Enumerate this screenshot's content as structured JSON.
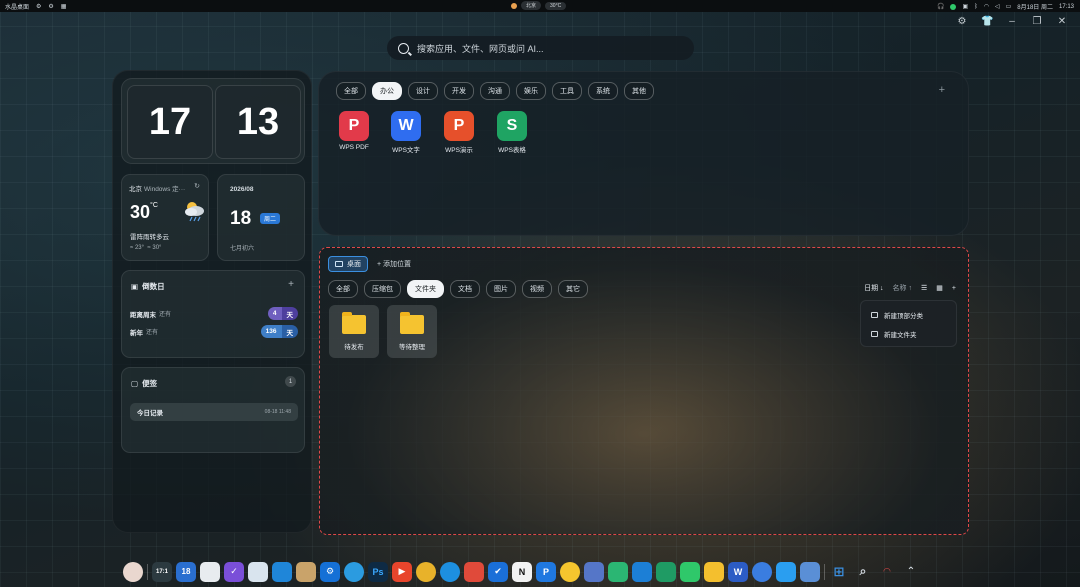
{
  "topbar": {
    "app_name": "水晶桌面",
    "center_label": "北京",
    "center_temp": "30°C",
    "date": "8月18日 周二",
    "time": "17:13"
  },
  "search": {
    "placeholder": "搜索应用、文件、网页或问 AI..."
  },
  "clock": {
    "hour": "17",
    "minute": "13"
  },
  "weather": {
    "city": "北京",
    "source": "Windows 定···",
    "temp": "30",
    "unit": "°C",
    "desc": "雷阵雨转多云",
    "low": "≈ 23°",
    "high": "≈ 30°"
  },
  "date_card": {
    "year_month": "2026/08",
    "day": "18",
    "weekday": "周二",
    "lunar": "七月初六"
  },
  "countdown": {
    "title": "倒数日",
    "items": [
      {
        "name": "距离周末",
        "prefix": "还有",
        "days": "4",
        "unit": "天",
        "color_n": "#6f5fbf",
        "color_u": "#4e3f9e"
      },
      {
        "name": "新年",
        "prefix": "还有",
        "days": "136",
        "unit": "天",
        "color_n": "#3f7fc7",
        "color_u": "#2a5fa5"
      }
    ]
  },
  "notes": {
    "title": "便签",
    "count": "1",
    "items": [
      {
        "title": "今日记录",
        "time": "08-18 11:48"
      }
    ]
  },
  "app_tabs": [
    "全部",
    "办公",
    "设计",
    "开发",
    "沟通",
    "娱乐",
    "工具",
    "系统",
    "其他"
  ],
  "app_tabs_active": "办公",
  "apps": [
    {
      "name": "WPS PDF",
      "glyph": "P",
      "color": "#e23a4a"
    },
    {
      "name": "WPS文字",
      "glyph": "W",
      "color": "#2f6df0"
    },
    {
      "name": "WPS演示",
      "glyph": "P",
      "color": "#e6502b"
    },
    {
      "name": "WPS表格",
      "glyph": "S",
      "color": "#1fa463"
    }
  ],
  "files": {
    "location": "桌面",
    "add_location": "+ 添加位置",
    "tabs": [
      "全部",
      "压缩包",
      "文件夹",
      "文档",
      "图片",
      "视频",
      "其它"
    ],
    "active_tab": "文件夹",
    "sort_date": "日期 ↓",
    "sort_name": "名称 ↑",
    "folders": [
      "待发布",
      "等待整理"
    ],
    "menu": [
      "新建顶部分类",
      "新建文件夹"
    ]
  },
  "taskbar": {
    "clock_label": "17:1",
    "calendar_label": "18",
    "ps_label": "Ps",
    "notion_label": "N",
    "p_label": "P",
    "w_label": "W"
  }
}
